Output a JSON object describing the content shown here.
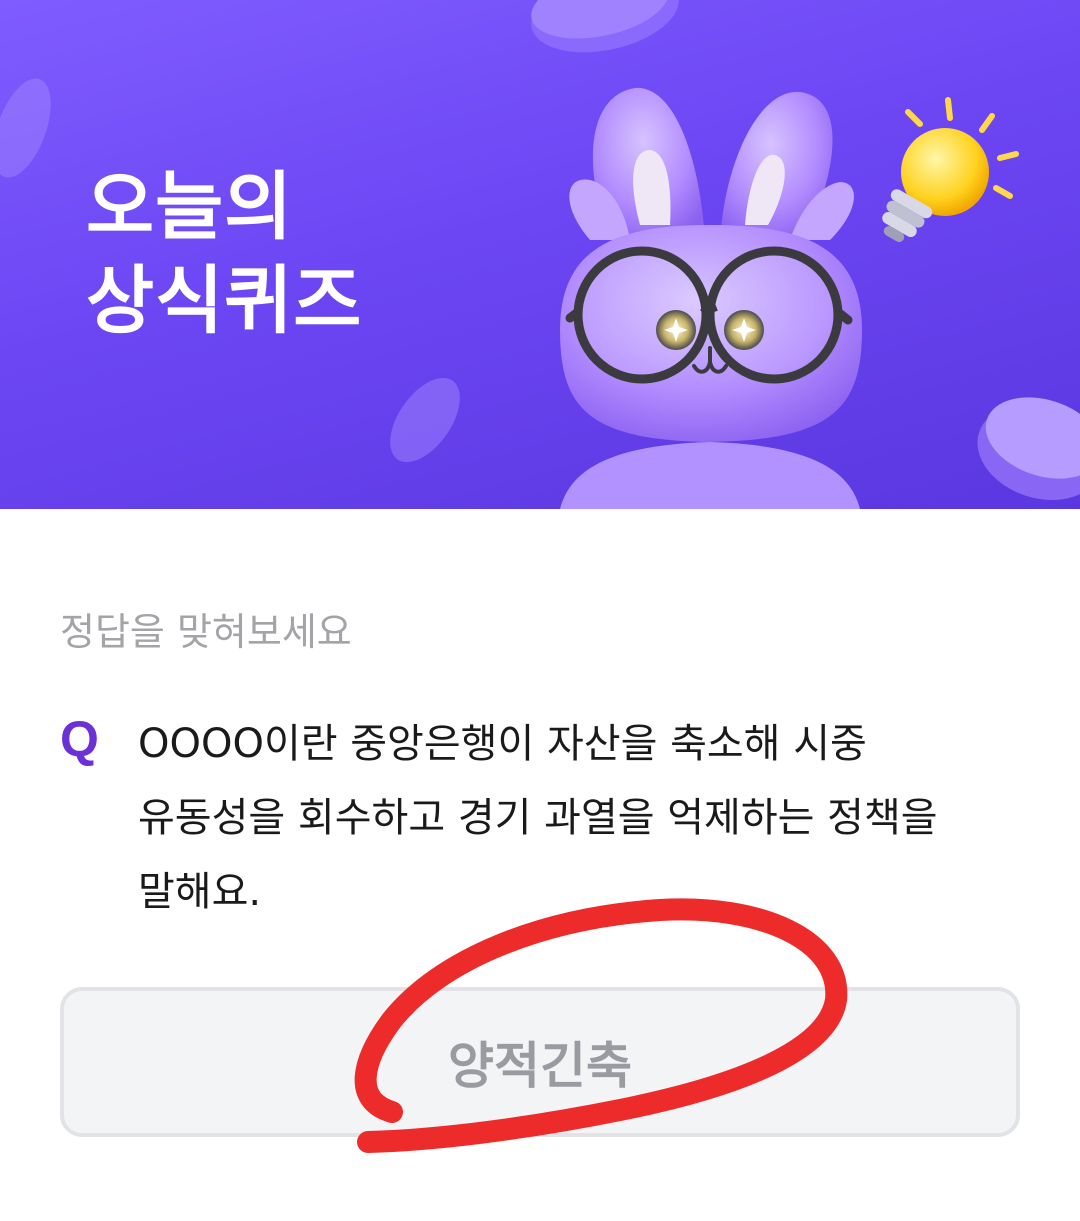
{
  "banner": {
    "title_line1": "오늘의",
    "title_line2": "상식퀴즈",
    "illustration": "purple-rabbit-with-glasses",
    "icons": [
      "light-bulb-icon",
      "coin-icon"
    ]
  },
  "quiz": {
    "hint": "정답을 맞혀보세요",
    "q_label": "Q",
    "question": "OOOO이란 중앙은행이 자산을 축소해 시중 유동성을 회수하고 경기 과열을 억제하는 정책을 말해요.",
    "answer": "양적긴축"
  },
  "colors": {
    "banner": "#6c46f3",
    "accent": "#6b30d6",
    "annotation": "#ee2b2b"
  }
}
